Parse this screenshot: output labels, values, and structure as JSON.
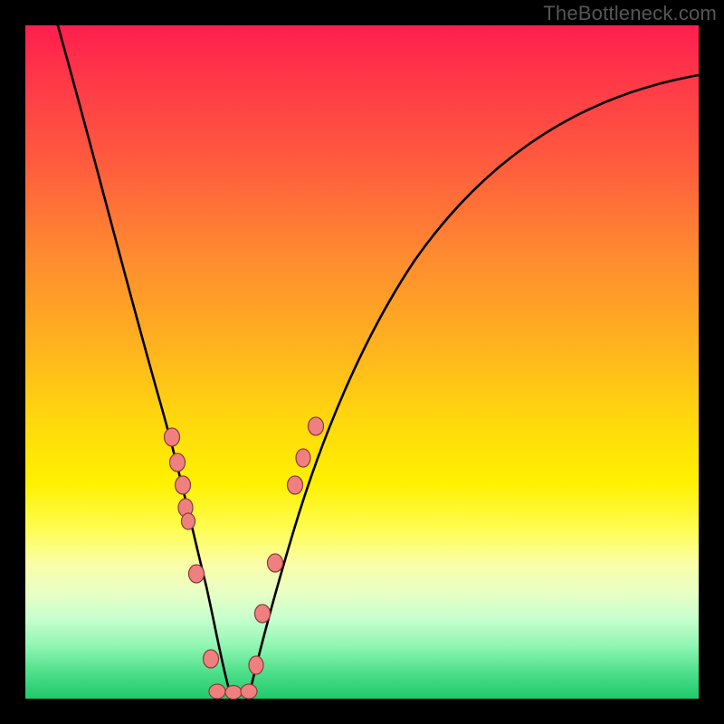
{
  "watermark": "TheBottleneck.com",
  "chart_data": {
    "type": "line",
    "title": "",
    "xlabel": "",
    "ylabel": "",
    "xlim": [
      0,
      1
    ],
    "ylim": [
      0,
      1
    ],
    "series": [
      {
        "name": "curve",
        "x": [
          0.0,
          0.04,
          0.08,
          0.12,
          0.16,
          0.2,
          0.24,
          0.27,
          0.3,
          0.33,
          0.37,
          0.4,
          0.45,
          0.5,
          0.55,
          0.6,
          0.68,
          0.76,
          0.84,
          0.92,
          1.0
        ],
        "y": [
          1.0,
          0.9,
          0.79,
          0.67,
          0.55,
          0.43,
          0.3,
          0.17,
          0.0,
          0.0,
          0.1,
          0.23,
          0.37,
          0.48,
          0.57,
          0.64,
          0.73,
          0.8,
          0.85,
          0.89,
          0.92
        ]
      },
      {
        "name": "left-pink-dots",
        "x": [
          0.217,
          0.225,
          0.232,
          0.237,
          0.24,
          0.254,
          0.277,
          0.283
        ],
        "y": [
          0.39,
          0.35,
          0.316,
          0.283,
          0.26,
          0.18,
          0.055,
          0.0
        ]
      },
      {
        "name": "right-pink-dots",
        "x": [
          0.33,
          0.34,
          0.352,
          0.37,
          0.4,
          0.41,
          0.43
        ],
        "y": [
          0.0,
          0.05,
          0.127,
          0.2,
          0.32,
          0.36,
          0.4
        ]
      }
    ],
    "colors": {
      "curve": "#000000",
      "dots_fill": "#F08080",
      "dots_stroke": "#803030"
    }
  }
}
